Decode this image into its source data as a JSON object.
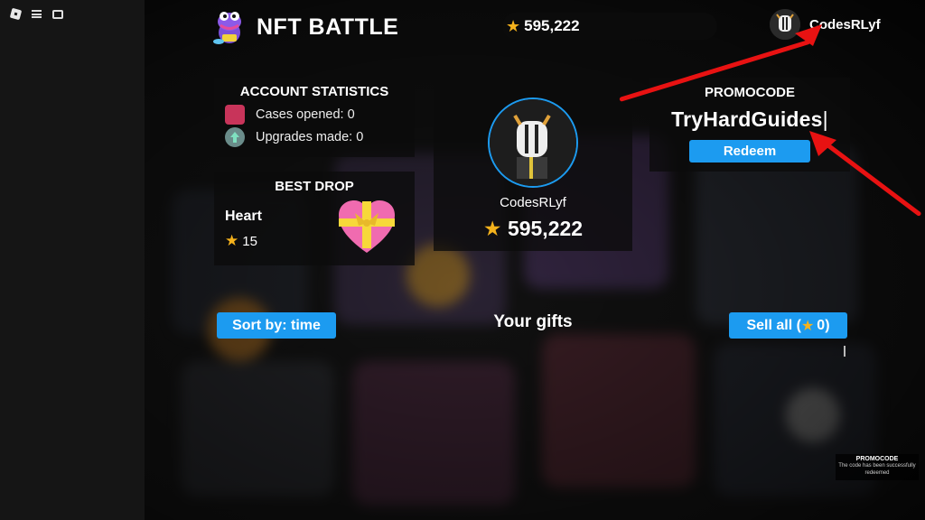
{
  "header": {
    "title": "NFT BATTLE",
    "balance": "595,222",
    "username": "CodesRLyf"
  },
  "stats": {
    "title": "ACCOUNT STATISTICS",
    "cases_label": "Cases opened: 0",
    "upgrades_label": "Upgrades made: 0"
  },
  "best_drop": {
    "title": "BEST DROP",
    "item_name": "Heart",
    "item_value": "15"
  },
  "profile": {
    "name": "CodesRLyf",
    "balance": "595,222"
  },
  "promocode": {
    "title": "PROMOCODE",
    "input_value": "TryHardGuides",
    "redeem_label": "Redeem"
  },
  "gifts": {
    "sort_label": "Sort by: time",
    "heading": "Your gifts",
    "sell_all_prefix": "Sell all (",
    "sell_all_count": "0",
    "sell_all_suffix": ")"
  },
  "toast": {
    "title": "PROMOCODE",
    "message": "The code has been successfully redeemed"
  },
  "colors": {
    "accent": "#1c9bf0",
    "star": "#f5b21c",
    "arrow": "#e81212"
  }
}
